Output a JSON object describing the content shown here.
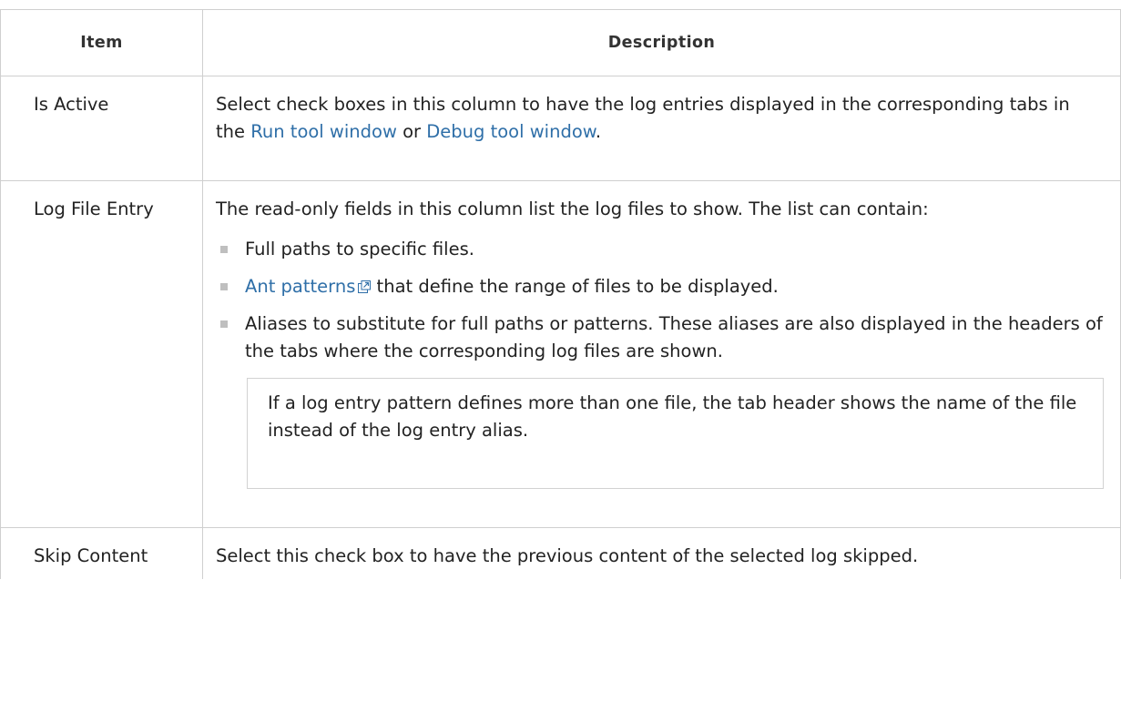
{
  "header": {
    "item": "Item",
    "description": "Description"
  },
  "rows": [
    {
      "item": "Is Active",
      "description": {
        "text_before": "Select check boxes in this column to have the log entries displayed in the corresponding tabs in the ",
        "link1": "Run tool window",
        "text_between": " or ",
        "link2": "Debug tool window",
        "text_after": "."
      }
    },
    {
      "item": "Log File Entry",
      "description": {
        "intro": "The read-only fields in this column list the log files to show. The list can contain:",
        "bullets": [
          {
            "text": "Full paths to specific files."
          },
          {
            "link": "Ant patterns",
            "text": " that define the range of files to be displayed."
          },
          {
            "text": "Aliases to substitute for full paths or patterns. These aliases are also displayed in the headers of the tabs where the corresponding log files are shown."
          }
        ],
        "note": "If a log entry pattern defines more than one file, the tab header shows the name of the file instead of the log entry alias."
      }
    },
    {
      "item": "Skip Content",
      "description": {
        "text": "Select this check box to have the previous content of the selected log skipped."
      }
    }
  ],
  "colors": {
    "link": "#2f6fa8",
    "border": "#cfcfcf",
    "bullet": "#bfbfbf"
  },
  "icons": {
    "external_link": "external-link-icon"
  }
}
